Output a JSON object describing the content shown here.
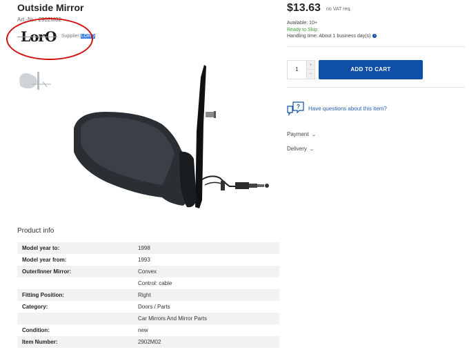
{
  "product": {
    "title": "Outside Mirror",
    "art_label": "Art.-Nr.:",
    "art_number": "2902M02",
    "brand_logo_text": "LorO",
    "supplier_label": "Supplier:",
    "supplier_value": "LORO"
  },
  "purchase": {
    "price": "$13.63",
    "vat_note": "no VAT req.",
    "available": "Available: 10+",
    "ready": "Ready to Ship",
    "handling": "Handling time: About 1 business day(s)",
    "quantity": "1",
    "plus": "+",
    "minus": "−",
    "add_to_cart": "ADD TO CART",
    "questions": "Have questions about this item?",
    "payment": "Payment",
    "delivery": "Delivery"
  },
  "product_info": {
    "heading": "Product info",
    "rows": [
      {
        "key": "Model year to:",
        "value": "1998"
      },
      {
        "key": "Model year from:",
        "value": "1993"
      },
      {
        "key": "Outer/Inner Mirror:",
        "value": "Convex"
      },
      {
        "key": "",
        "value": "Control: cable"
      },
      {
        "key": "Fitting Position:",
        "value": "Right"
      },
      {
        "key": "Category:",
        "value": "Doors / Parts"
      },
      {
        "key": "",
        "value": "Car Mirrors And Mirror Parts"
      },
      {
        "key": "Condition:",
        "value": "new"
      },
      {
        "key": "Item Number:",
        "value": "2902M02"
      }
    ]
  },
  "colors": {
    "accent": "#0f4fa8",
    "highlight_circle": "#d40d0d",
    "ready_green": "#3a9a3a",
    "link_blue": "#2a5db0"
  },
  "icons": [
    "info-icon",
    "question-chat-icon",
    "chevron-down-icon"
  ]
}
